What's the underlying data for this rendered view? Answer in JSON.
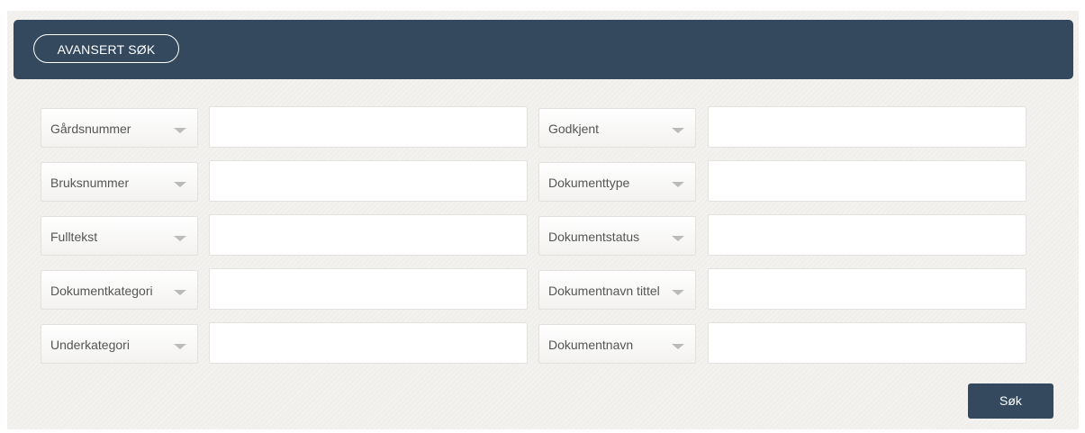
{
  "header": {
    "title": "AVANSERT SØK"
  },
  "left_rows": [
    {
      "select_label": "Gårdsnummer",
      "value": ""
    },
    {
      "select_label": "Bruksnummer",
      "value": ""
    },
    {
      "select_label": "Fulltekst",
      "value": ""
    },
    {
      "select_label": "Dokumentkategori",
      "value": ""
    },
    {
      "select_label": "Underkategori",
      "value": ""
    }
  ],
  "right_rows": [
    {
      "select_label": "Godkjent",
      "value": ""
    },
    {
      "select_label": "Dokumenttype",
      "value": ""
    },
    {
      "select_label": "Dokumentstatus",
      "value": ""
    },
    {
      "select_label": "Dokumentnavn tittel",
      "value": ""
    },
    {
      "select_label": "Dokumentnavn",
      "value": ""
    }
  ],
  "icons": {
    "select_caret": "chevron-down-icon"
  },
  "colors": {
    "header_bg": "#34495e",
    "button_bg": "#34495e",
    "page_bg": "#f1efec"
  },
  "actions": {
    "search_label": "Søk"
  }
}
